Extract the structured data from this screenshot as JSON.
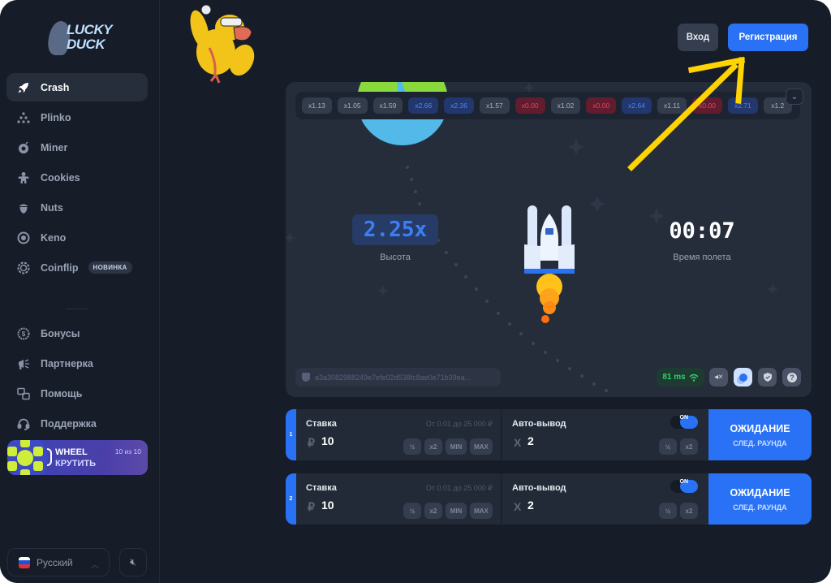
{
  "brand": {
    "line1": "LUCKY",
    "line2": "DUCK"
  },
  "sidebar": {
    "games": [
      {
        "label": "Crash",
        "icon": "rocket-icon",
        "active": true
      },
      {
        "label": "Plinko",
        "icon": "plinko-dots-icon"
      },
      {
        "label": "Miner",
        "icon": "bomb-icon"
      },
      {
        "label": "Cookies",
        "icon": "gingerbread-icon"
      },
      {
        "label": "Nuts",
        "icon": "acorn-icon"
      },
      {
        "label": "Keno",
        "icon": "keno-ball-icon"
      },
      {
        "label": "Coinflip",
        "icon": "coin-icon",
        "badge": "НОВИНКА"
      }
    ],
    "links": [
      {
        "label": "Бонусы",
        "icon": "bonus-coin-icon"
      },
      {
        "label": "Партнерка",
        "icon": "megaphone-icon"
      },
      {
        "label": "Помощь",
        "icon": "help-chat-icon"
      },
      {
        "label": "Поддержка",
        "icon": "headset-icon"
      }
    ],
    "wheel": {
      "title": "WHEEL",
      "action": "КРУТИТЬ",
      "count": "10 из 10"
    },
    "language": "Русский",
    "flag_colors": [
      "#ffffff",
      "#1e50d8",
      "#e0303a"
    ]
  },
  "header": {
    "login": "Вход",
    "register": "Регистрация"
  },
  "game": {
    "history": [
      {
        "v": "x1.13",
        "t": "gray"
      },
      {
        "v": "x1.05",
        "t": "gray"
      },
      {
        "v": "x1.59",
        "t": "gray"
      },
      {
        "v": "x2.66",
        "t": "blue"
      },
      {
        "v": "x2.36",
        "t": "blue"
      },
      {
        "v": "x1.57",
        "t": "gray"
      },
      {
        "v": "x0.00",
        "t": "red"
      },
      {
        "v": "x1.02",
        "t": "gray"
      },
      {
        "v": "x0.00",
        "t": "red"
      },
      {
        "v": "x2.64",
        "t": "blue"
      },
      {
        "v": "x1.11",
        "t": "gray"
      },
      {
        "v": "x0.00",
        "t": "red"
      },
      {
        "v": "x2.71",
        "t": "blue"
      },
      {
        "v": "x1.2",
        "t": "gray"
      }
    ],
    "multiplier": "2.25x",
    "multiplier_label": "Высота",
    "timer": "00:07",
    "timer_label": "Время полета",
    "seed_hash": "a3a3082988249e7efe02d538fc8ae0e71b39ea...",
    "ping": "81 ms"
  },
  "bets": [
    {
      "index": "1",
      "stake_label": "Ставка",
      "range": "От 0.01 до 25 000 ₽",
      "currency": "₽",
      "amount": "10",
      "stake_buttons": [
        "½",
        "x2",
        "MIN",
        "MAX"
      ],
      "auto_label": "Авто-вывод",
      "auto_toggle": "ON",
      "auto_prefix": "X",
      "auto_value": "2",
      "auto_buttons": [
        "½",
        "x2"
      ],
      "action_title": "ОЖИДАНИЕ",
      "action_sub": "СЛЕД. РАУНДА"
    },
    {
      "index": "2",
      "stake_label": "Ставка",
      "range": "От 0.01 до 25 000 ₽",
      "currency": "₽",
      "amount": "10",
      "stake_buttons": [
        "½",
        "x2",
        "MIN",
        "MAX"
      ],
      "auto_label": "Авто-вывод",
      "auto_toggle": "ON",
      "auto_prefix": "X",
      "auto_value": "2",
      "auto_buttons": [
        "½",
        "x2"
      ],
      "action_title": "ОЖИДАНИЕ",
      "action_sub": "СЛЕД. РАУНДА"
    }
  ],
  "colors": {
    "accent": "#2a72f5",
    "annotation_arrow": "#ffd400",
    "win": "#4f86f2",
    "loss": "#e2445f",
    "ping": "#2fd26a"
  }
}
